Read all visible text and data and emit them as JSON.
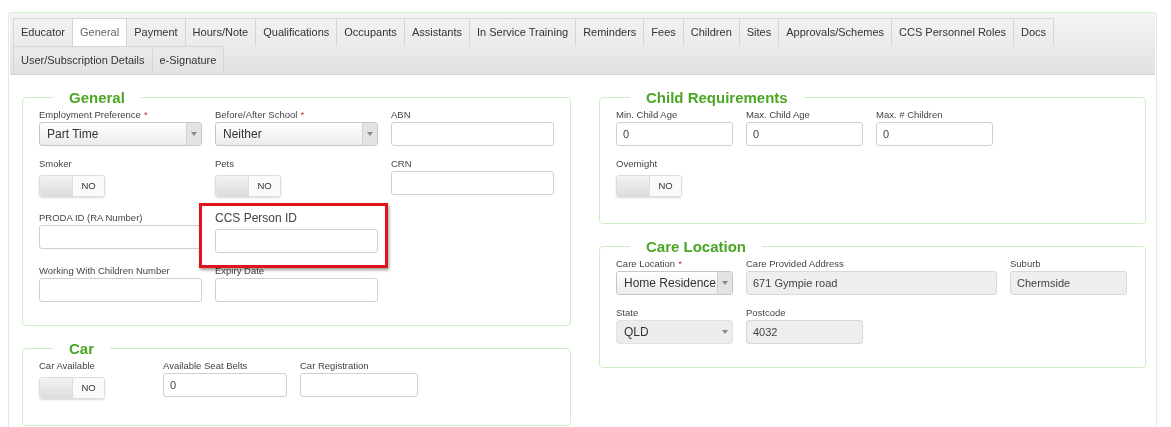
{
  "tabs": [
    {
      "label": "Educator",
      "selected": false
    },
    {
      "label": "General",
      "selected": true
    },
    {
      "label": "Payment",
      "selected": false
    },
    {
      "label": "Hours/Note",
      "selected": false
    },
    {
      "label": "Qualifications",
      "selected": false
    },
    {
      "label": "Occupants",
      "selected": false
    },
    {
      "label": "Assistants",
      "selected": false
    },
    {
      "label": "In Service Training",
      "selected": false
    },
    {
      "label": "Reminders",
      "selected": false
    },
    {
      "label": "Fees",
      "selected": false
    },
    {
      "label": "Children",
      "selected": false
    },
    {
      "label": "Sites",
      "selected": false
    },
    {
      "label": "Approvals/Schemes",
      "selected": false
    },
    {
      "label": "CCS Personnel Roles",
      "selected": false
    },
    {
      "label": "Docs",
      "selected": false
    },
    {
      "label": "User/Subscription Details",
      "selected": false
    },
    {
      "label": "e-Signature",
      "selected": false
    }
  ],
  "columns": [
    [
      {
        "title": "General",
        "rows": [
          [
            {
              "kind": "select",
              "label": "Employment Preference",
              "required": "*",
              "value": "Part Time",
              "disabled": false
            },
            {
              "kind": "select",
              "label": "Before/After School",
              "required": "*",
              "value": "Neither",
              "disabled": false
            },
            {
              "kind": "text",
              "label": "ABN",
              "disabled": false
            }
          ],
          [
            {
              "kind": "toggle",
              "label": "Smoker",
              "on": false,
              "value": "NO"
            },
            {
              "kind": "toggle",
              "label": "Pets",
              "on": false,
              "value": "NO"
            },
            {
              "kind": "text",
              "label": "CRN",
              "disabled": false
            }
          ],
          [
            {
              "kind": "text",
              "label": "PRODA ID (RA Number)",
              "disabled": false
            },
            {
              "kind": "text",
              "label": "CCS Person ID",
              "disabled": false,
              "highlighted": true
            }
          ],
          [
            {
              "kind": "text",
              "label": "Working With Children Number",
              "disabled": false
            },
            {
              "kind": "text",
              "label": "Expiry Date",
              "disabled": false
            }
          ]
        ]
      },
      {
        "title": "Car",
        "rows": [
          [
            {
              "kind": "toggle",
              "label": "Car Available",
              "on": false,
              "value": "NO"
            },
            {
              "kind": "text",
              "label": "Available Seat Belts",
              "value": "0",
              "disabled": false
            },
            {
              "kind": "text",
              "label": "Car Registration",
              "disabled": false
            }
          ]
        ]
      }
    ],
    [
      {
        "title": "Child Requirements",
        "rows": [
          [
            {
              "kind": "text",
              "label": "Min. Child Age",
              "value": "0",
              "disabled": false
            },
            {
              "kind": "text",
              "label": "Max. Child Age",
              "value": "0",
              "disabled": false
            },
            {
              "kind": "text",
              "label": "Max. # Children",
              "value": "0",
              "disabled": false
            }
          ],
          [
            {
              "kind": "toggle",
              "label": "Overnight",
              "on": false,
              "value": "NO"
            }
          ]
        ]
      },
      {
        "title": "Care Location",
        "rows": [
          [
            {
              "kind": "select",
              "label": "Care Location",
              "required": "*",
              "value": "Home Residence",
              "disabled": false
            },
            {
              "kind": "text",
              "label": "Care Provided Address",
              "value": "671 Gympie road",
              "disabled": true
            },
            {
              "kind": "text",
              "label": "Suburb",
              "value": "Chermside",
              "disabled": true
            }
          ],
          [
            {
              "kind": "select",
              "label": "State",
              "value": "QLD",
              "disabled": true
            },
            {
              "kind": "text",
              "label": "Postcode",
              "value": "4032",
              "disabled": true
            }
          ]
        ]
      }
    ]
  ]
}
